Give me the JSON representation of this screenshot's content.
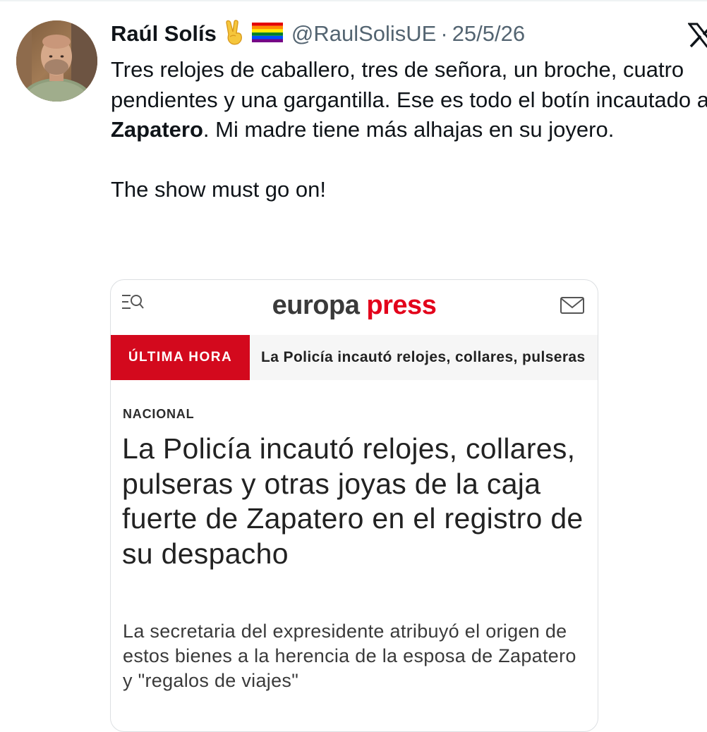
{
  "tweet": {
    "author_name": "Raúl Solís",
    "name_emojis": "✌️ 🏳️‍🌈",
    "handle": "@RaulSolisUE",
    "separator": "·",
    "date": "25/5/26",
    "text_line1_before": "Tres relojes de caballero, tres de señora, un broche, cuatro pendientes y una gargantilla. Ese es todo el botín incautado a ",
    "text_line1_bold": "Zapatero",
    "text_line1_after": ". Mi madre tiene más alhajas en su joyero.",
    "text_line2": "The show must go on!"
  },
  "icons": {
    "avatar": "profile-photo",
    "victory_hand": "victory-hand-emoji-icon",
    "rainbow_flag": "rainbow-flag-emoji-icon",
    "x_logo": "x-logo-icon",
    "menu_search": "menu-search-icon",
    "mail": "mail-icon"
  },
  "card": {
    "brand_part1": "europa",
    "brand_part2": "press",
    "ticker_label": "ÚLTIMA HORA",
    "ticker_text": "La Policía incautó relojes, collares, pulseras",
    "section": "NACIONAL",
    "headline": "La Policía incautó relojes, collares, pulseras y otras joyas de la caja fuerte de Zapatero en el registro de su despacho",
    "dek": "La secretaria del expresidente atribuyó el origen de estos bienes a la herencia de la esposa de Zapatero y \"regalos de viajes\""
  },
  "colors": {
    "brand_red": "#e3001b",
    "ticker_red": "#d3091d",
    "muted_text": "#536471",
    "text": "#0f1419"
  }
}
